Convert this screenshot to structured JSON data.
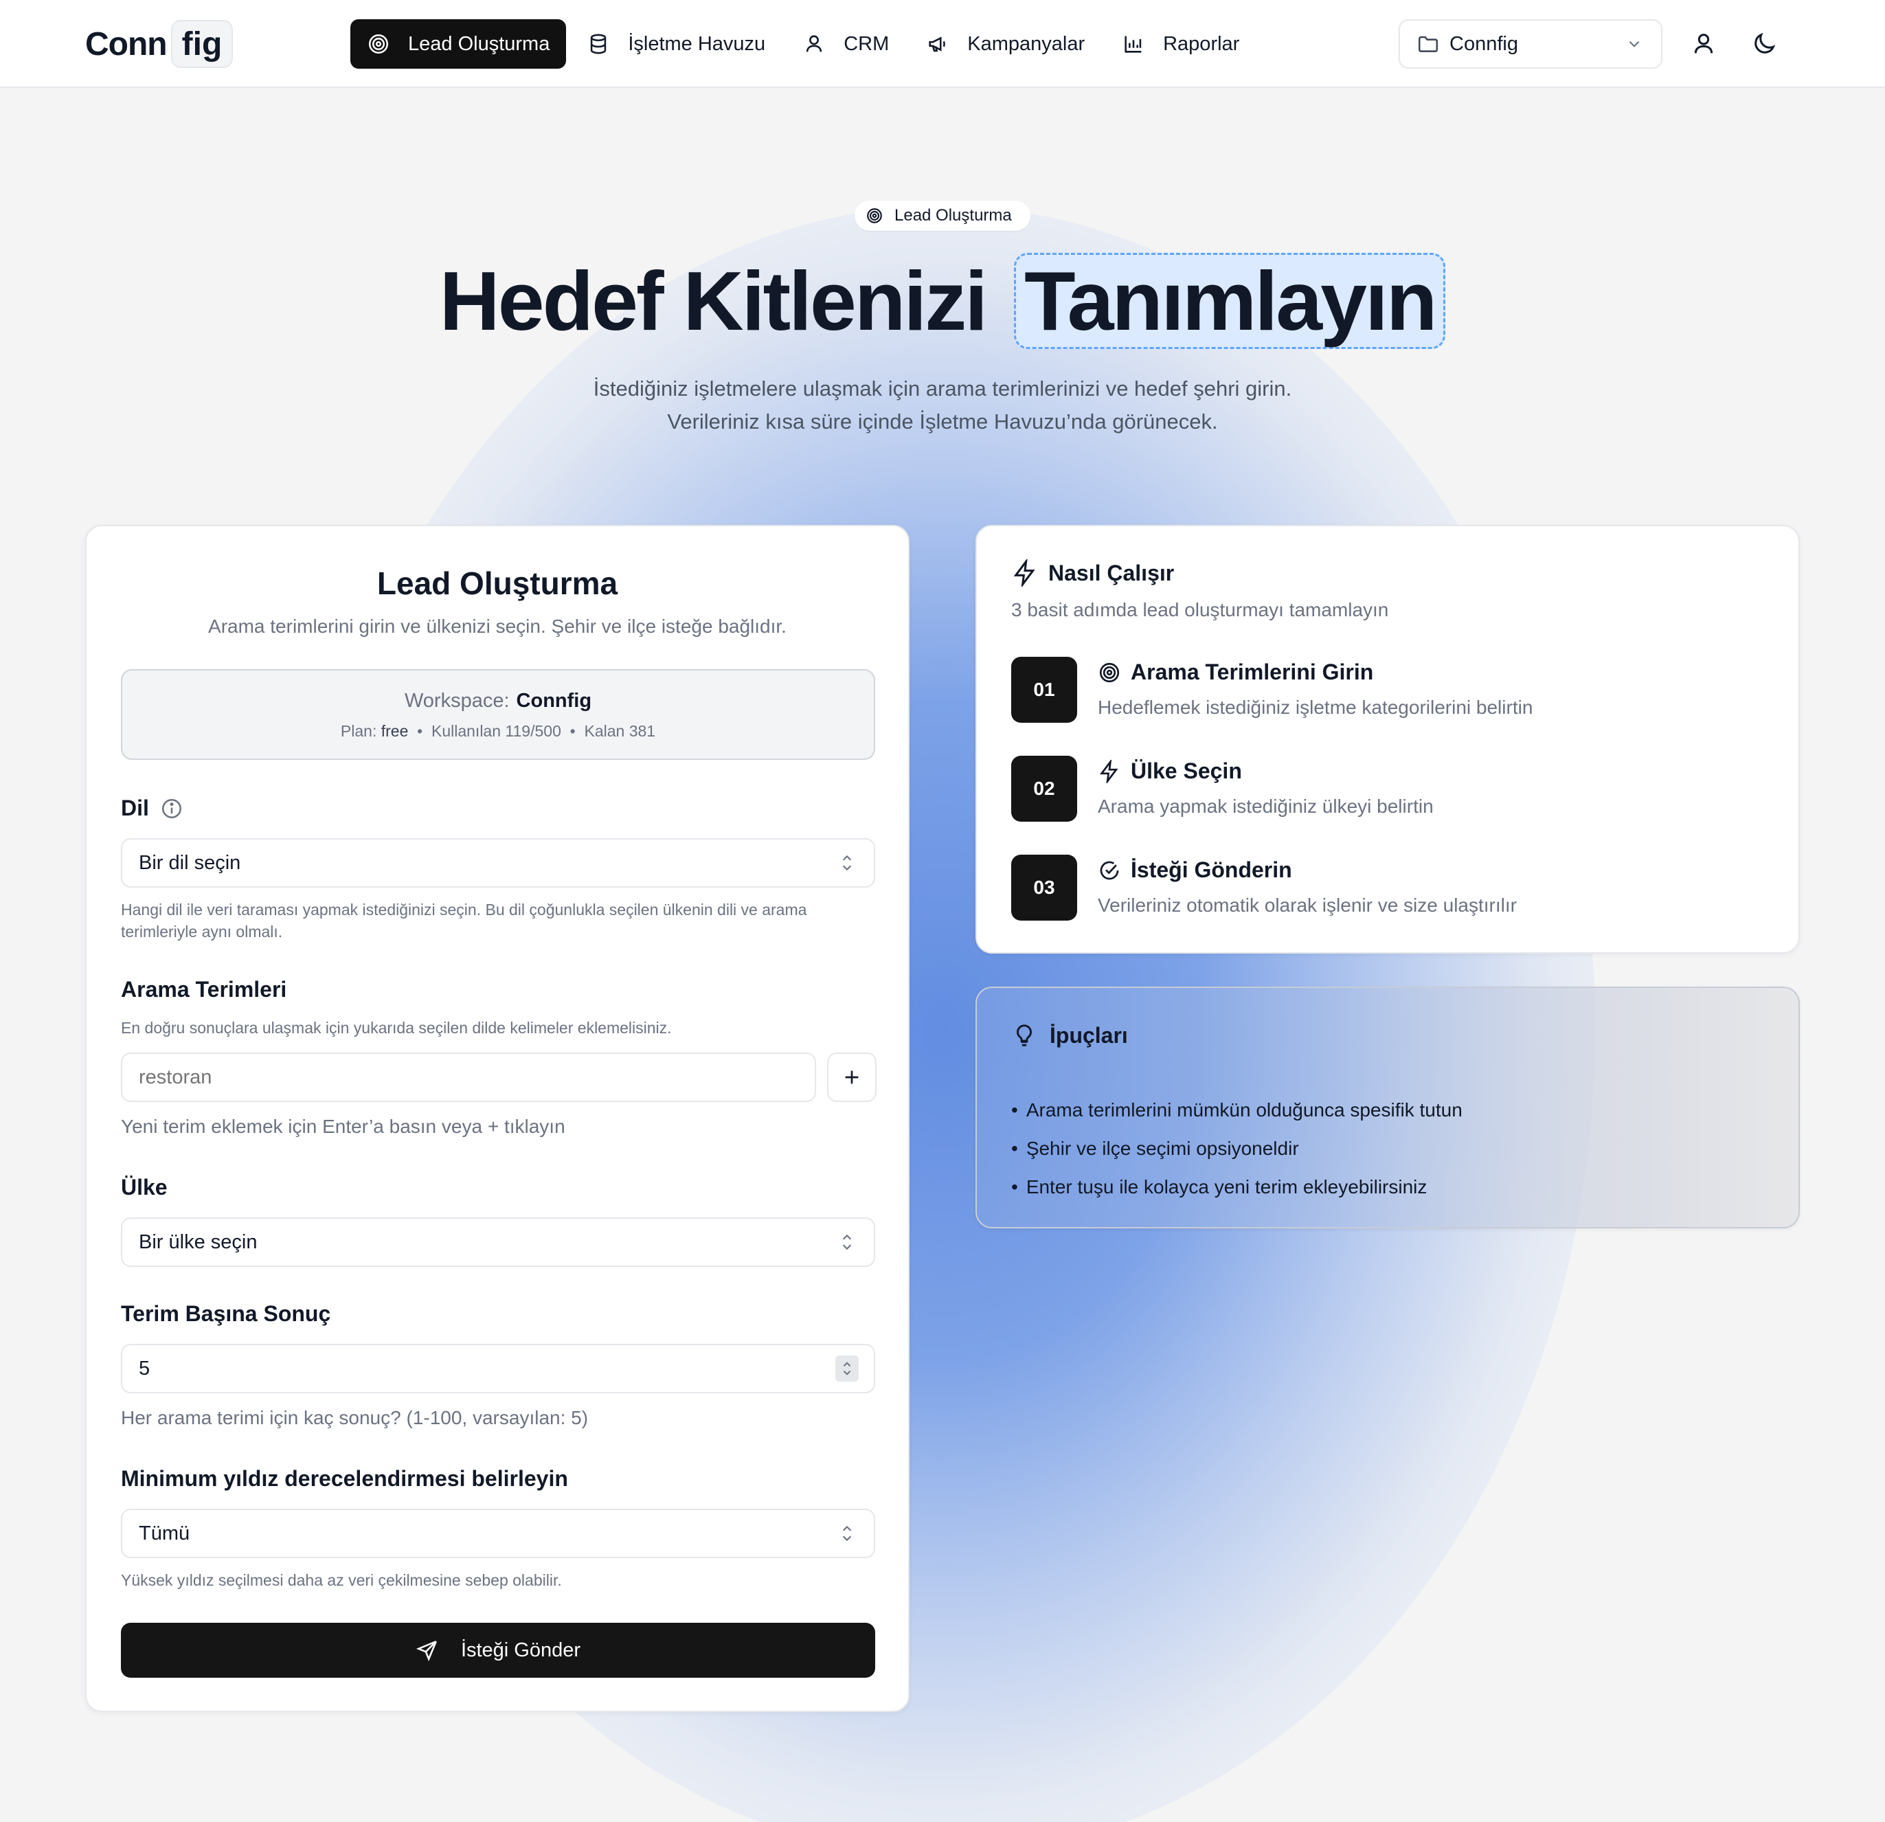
{
  "nav": {
    "logo_left": "Conn",
    "logo_right": "fig",
    "items": [
      {
        "label": "Lead Oluşturma",
        "icon": "target-icon",
        "active": true
      },
      {
        "label": "İşletme Havuzu",
        "icon": "database-icon",
        "active": false
      },
      {
        "label": "CRM",
        "icon": "user-icon",
        "active": false
      },
      {
        "label": "Kampanyalar",
        "icon": "megaphone-icon",
        "active": false
      },
      {
        "label": "Raporlar",
        "icon": "bar-chart-icon",
        "active": false
      }
    ],
    "workspace_select": "Connfig"
  },
  "hero": {
    "badge": "Lead Oluşturma",
    "title_main": "Hedef Kitlenizi",
    "title_highlight": "Tanımlayın",
    "subtitle_line1": "İstediğiniz işletmelere ulaşmak için arama terimlerinizi ve hedef şehri girin.",
    "subtitle_line2": "Verileriniz kısa süre içinde İşletme Havuzu’nda görünecek."
  },
  "form": {
    "title": "Lead Oluşturma",
    "subtitle": "Arama terimlerini girin ve ülkenizi seçin. Şehir ve ilçe isteğe bağlıdır.",
    "workspace": {
      "label": "Workspace:",
      "name": "Connfig",
      "plan_label": "Plan:",
      "plan_value": "free",
      "used_label": "Kullanılan",
      "used_value": "119/500",
      "remaining_label": "Kalan",
      "remaining_value": "381"
    },
    "language": {
      "label": "Dil",
      "value": "Bir dil seçin",
      "help": "Hangi dil ile veri taraması yapmak istediğinizi seçin. Bu dil çoğunlukla seçilen ülkenin dili ve arama terimleriyle aynı olmalı."
    },
    "terms": {
      "label": "Arama Terimleri",
      "help_top": "En doğru sonuçlara ulaşmak için yukarıda seçilen dilde kelimeler eklemelisiniz.",
      "placeholder": "restoran",
      "help_bottom": "Yeni terim eklemek için Enter’a basın veya + tıklayın"
    },
    "country": {
      "label": "Ülke",
      "value": "Bir ülke seçin"
    },
    "results": {
      "label": "Terim Başına Sonuç",
      "value": "5",
      "help": "Her arama terimi için kaç sonuç? (1-100, varsayılan: 5)"
    },
    "rating": {
      "label": "Minimum yıldız derecelendirmesi belirleyin",
      "value": "Tümü",
      "help": "Yüksek yıldız seçilmesi daha az veri çekilmesine sebep olabilir."
    },
    "submit_label": "İsteği Gönder"
  },
  "how": {
    "title": "Nasıl Çalışır",
    "subtitle": "3 basit adımda lead oluşturmayı tamamlayın",
    "steps": [
      {
        "num": "01",
        "title": "Arama Terimlerini Girin",
        "desc": "Hedeflemek istediğiniz işletme kategorilerini belirtin",
        "icon": "target-icon"
      },
      {
        "num": "02",
        "title": "Ülke Seçin",
        "desc": "Arama yapmak istediğiniz ülkeyi belirtin",
        "icon": "bolt-icon"
      },
      {
        "num": "03",
        "title": "İsteği Gönderin",
        "desc": "Verileriniz otomatik olarak işlenir ve size ulaştırılır",
        "icon": "check-circle-icon"
      }
    ]
  },
  "tips": {
    "title": "İpuçları",
    "items": [
      "Arama terimlerini mümkün olduğunca spesifik tutun",
      "Şehir ve ilçe seçimi opsiyoneldir",
      "Enter tuşu ile kolayca yeni terim ekleyebilirsiniz"
    ]
  }
}
